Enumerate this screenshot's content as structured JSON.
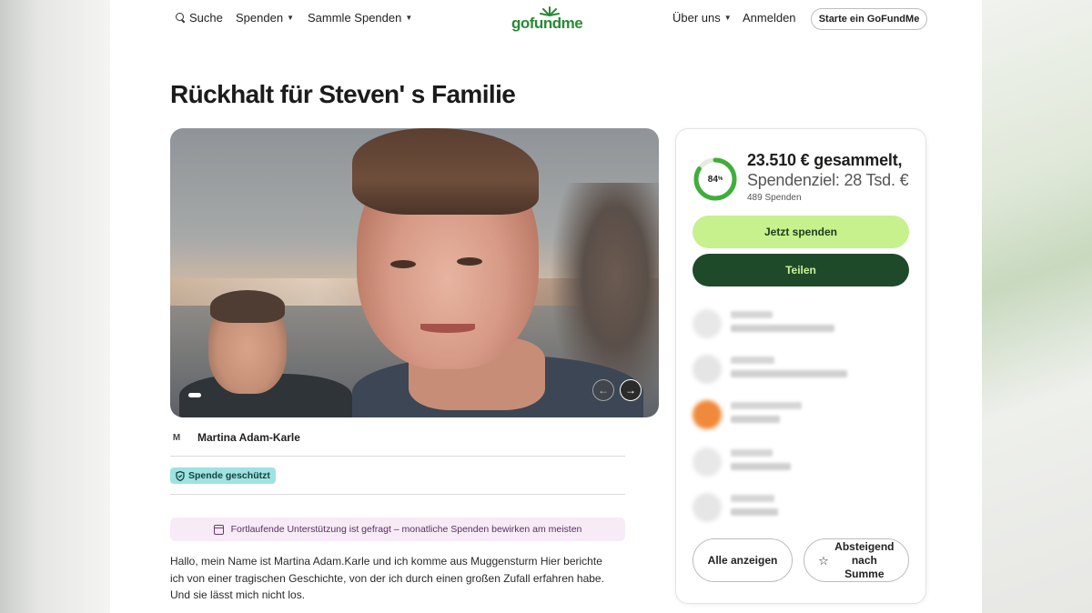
{
  "nav": {
    "search_label": "Suche",
    "donate_label": "Spenden",
    "collect_label": "Sammle Spenden",
    "about_label": "Über uns",
    "login_label": "Anmelden",
    "start_label": "Starte ein GoFundMe",
    "logo_text": "gofundme"
  },
  "campaign": {
    "title": "Rückhalt für Steven' s Familie",
    "organizer_initial": "M",
    "organizer_name": "Martina Adam-Karle",
    "protected_badge": "Spende geschützt",
    "notice": "Fortlaufende Unterstützung ist gefragt – monatliche Spenden bewirken am meisten",
    "story_line1": "Hallo, mein Name ist Martina Adam.Karle und ich komme aus Muggensturm Hier berichte",
    "story_line2": "ich von einer tragischen Geschichte, von der ich durch einen großen Zufall erfahren habe.",
    "story_line3": "Und sie lässt mich nicht los."
  },
  "progress": {
    "percent": 84,
    "percent_label": "84",
    "percent_sign": "%",
    "raised": "23.510 € gesammelt,",
    "goal": "Spendenziel: 28 Tsd. €",
    "donations": "489 Spenden"
  },
  "actions": {
    "donate": "Jetzt spenden",
    "share": "Teilen",
    "show_all": "Alle anzeigen",
    "sort": "Absteigend nach Summe"
  },
  "colors": {
    "brand_green": "#2a8a35",
    "donate_bg": "#c6f18d",
    "share_bg": "#1f4a2a",
    "badge_bg": "#9fe3e0",
    "notice_bg": "#f6ebf6"
  }
}
